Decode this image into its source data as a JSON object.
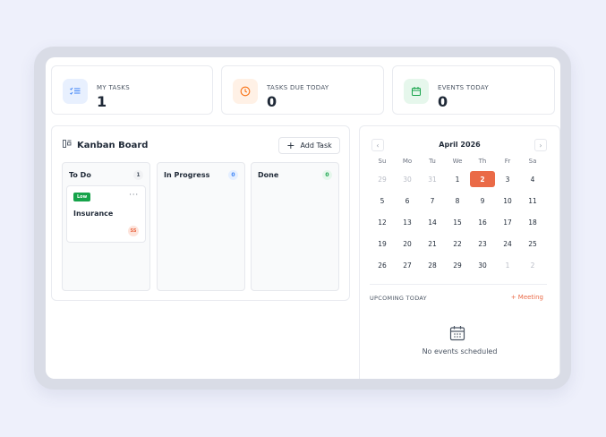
{
  "stats": [
    {
      "label": "MY TASKS",
      "value": "1",
      "icon": "checklist-icon",
      "color": "#3b82f6",
      "bg": "#e8f0fe"
    },
    {
      "label": "TASKS DUE TODAY",
      "value": "0",
      "icon": "clock-icon",
      "color": "#f97316",
      "bg": "#fff1e6"
    },
    {
      "label": "EVENTS TODAY",
      "value": "0",
      "icon": "calendar-icon",
      "color": "#16a34a",
      "bg": "#e6f7ec"
    }
  ],
  "kanban": {
    "title": "Kanban Board",
    "add_label": "Add Task",
    "add_icon": "+",
    "columns": [
      {
        "name": "To Do",
        "count": "1",
        "badge_bg": "#f1f2f4",
        "badge_fg": "#4b5563"
      },
      {
        "name": "In Progress",
        "count": "0",
        "badge_bg": "#e5efff",
        "badge_fg": "#3b82f6"
      },
      {
        "name": "Done",
        "count": "0",
        "badge_bg": "#e6f7ec",
        "badge_fg": "#16a34a"
      }
    ],
    "card": {
      "priority": "Low",
      "more": "···",
      "title": "Insurance",
      "assignee": "SS"
    }
  },
  "calendar": {
    "month_label": "April 2026",
    "prev": "‹",
    "next": "›",
    "weekdays": [
      "Su",
      "Mo",
      "Tu",
      "We",
      "Th",
      "Fr",
      "Sa"
    ],
    "weeks": [
      [
        "29",
        "30",
        "31",
        "1",
        "2",
        "3",
        "4"
      ],
      [
        "5",
        "6",
        "7",
        "8",
        "9",
        "10",
        "11"
      ],
      [
        "12",
        "13",
        "14",
        "15",
        "16",
        "17",
        "18"
      ],
      [
        "19",
        "20",
        "21",
        "22",
        "23",
        "24",
        "25"
      ],
      [
        "26",
        "27",
        "28",
        "29",
        "30",
        "1",
        "2"
      ]
    ],
    "today": "2",
    "upcoming_label": "UPCOMING TODAY",
    "meeting_label": "+ Meeting",
    "empty_text": "No events scheduled"
  }
}
